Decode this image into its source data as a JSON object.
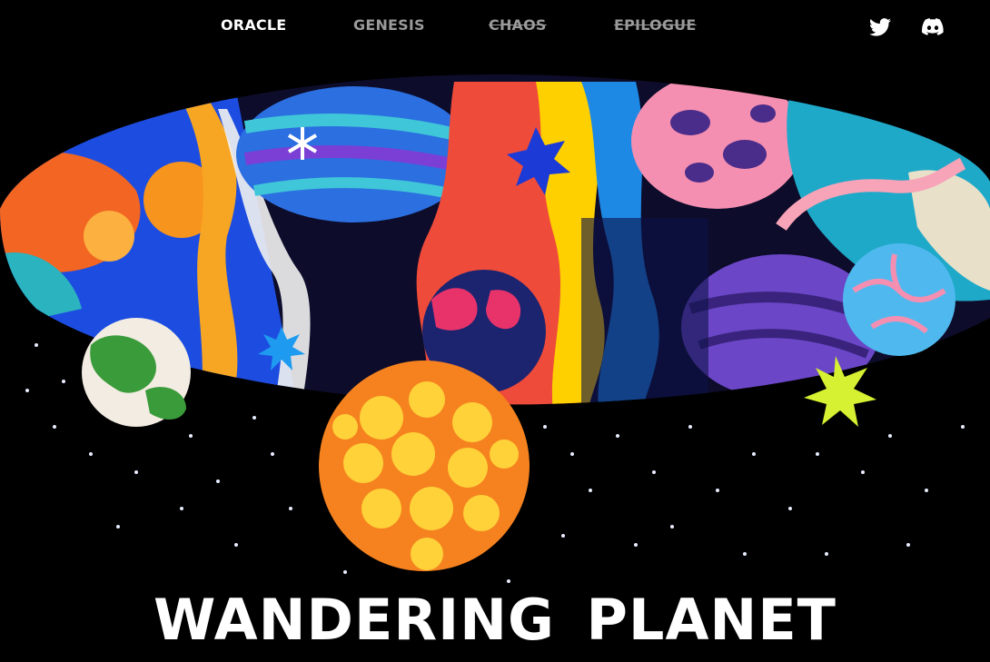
{
  "nav": {
    "items": [
      {
        "label": "ORACLE",
        "state": "active"
      },
      {
        "label": "GENESIS",
        "state": "inactive"
      },
      {
        "label": "CHAOS",
        "state": "locked"
      },
      {
        "label": "EPILOGUE",
        "state": "locked"
      }
    ]
  },
  "social": {
    "twitter_icon": "twitter-icon",
    "discord_icon": "discord-icon"
  },
  "hero": {
    "title": "WANDERING PLANET"
  },
  "colors": {
    "background": "#000000",
    "text": "#ffffff",
    "muted_nav": "#9a9a9a"
  }
}
